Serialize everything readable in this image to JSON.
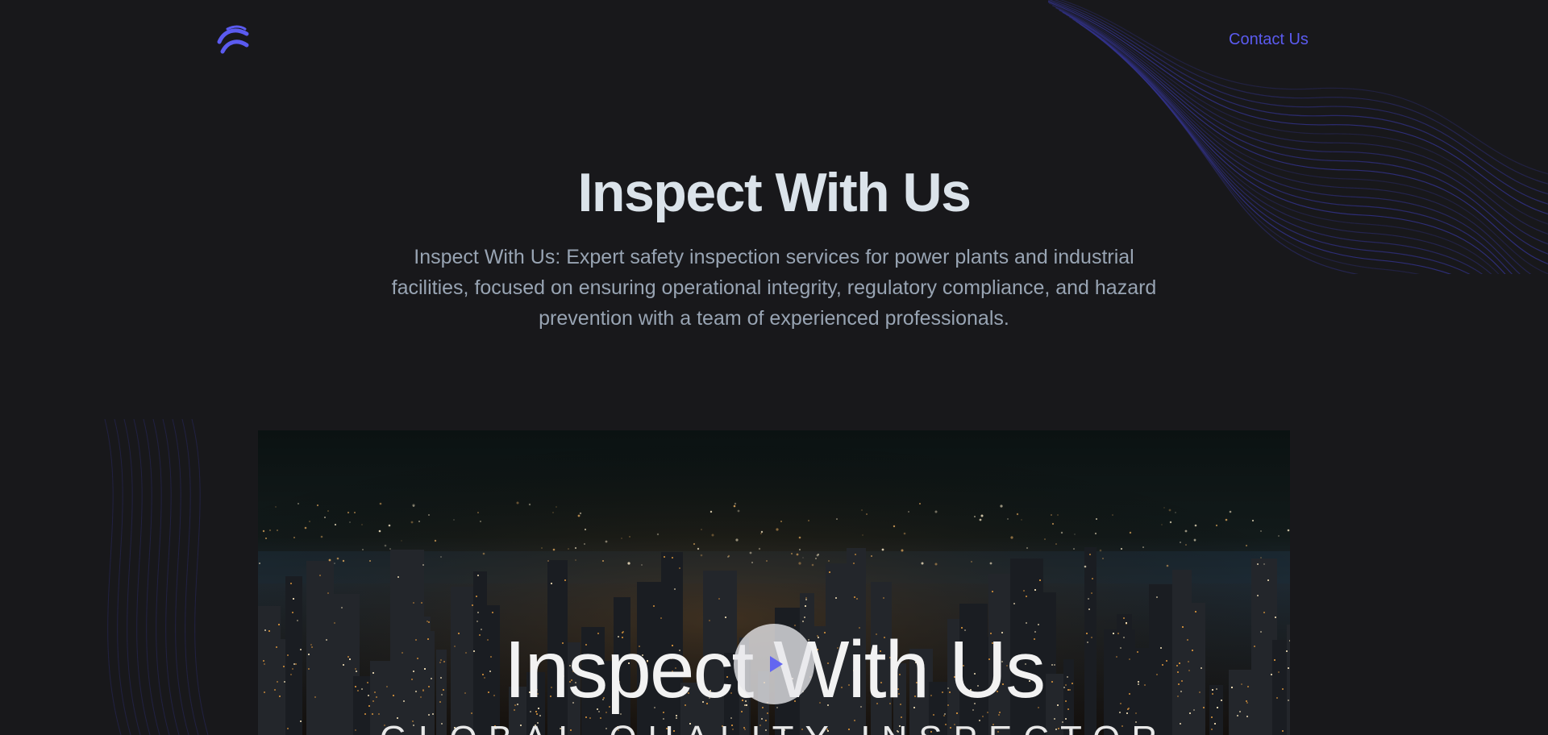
{
  "header": {
    "logo_icon": "chevron-arcs-logo-icon",
    "contact_label": "Contact Us"
  },
  "hero": {
    "title": "Inspect With Us",
    "description": "Inspect With Us: Expert safety inspection services for power plants and industrial facilities, focused on ensuring operational integrity, regulatory compliance, and hazard prevention with a team of experienced professionals."
  },
  "video": {
    "overlay_title": "Inspect With Us",
    "overlay_subtitle": "GLOBAL QUALITY INSPECTOR",
    "play_icon": "play-icon"
  },
  "colors": {
    "background": "#18181b",
    "accent": "#5b5bf0",
    "heading": "#dbe3ea",
    "body_text": "#98a4b3"
  }
}
